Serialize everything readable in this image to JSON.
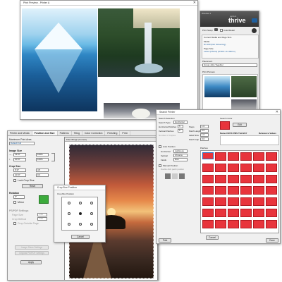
{
  "print_preview": {
    "title": "Print Preview - Printer A",
    "close_glyph": "✕"
  },
  "thrive": {
    "header_label": "Window 1",
    "logo_prefix": "perfect",
    "logo_main": "thrive",
    "print_setup_label": "Print Setup",
    "color_label": "Color/Detail",
    "current_media_label": "Current Media and Page Size",
    "media_label": "Media",
    "media_value": "Dit 100 (Dot Screening)",
    "page_size_label": "Page Size",
    "page_size_value": "Letter (8.5x11) (8.500 x 11.000 in)",
    "placement_label": "Placement",
    "placement_value": "Group Jobs Together",
    "print_preview_label": "Print Preview",
    "brand_color": "#1f5f9e"
  },
  "main": {
    "tabs": [
      "Printer and Media",
      "Position and Size",
      "Patterns",
      "Tiling",
      "Color Correction",
      "Finishing",
      "Print"
    ],
    "max_print_label": "Maximum Print Area",
    "max_print_value": "Default Full",
    "image_size_label": "Image Size",
    "img_w": "13.07",
    "img_w_pct": "100%",
    "img_h": "10.57",
    "img_h_pct": "100%",
    "crop_size_label": "Crop Size",
    "crop_w": "8.37",
    "crop_x": "4.8",
    "crop_h": "10.57",
    "crop_y": "0.0",
    "lock_crop_label": "Lock Crop Size",
    "reset_label": "Reset",
    "rotation_label": "Rotation",
    "rotation_value": "0°",
    "mirror_label": "Mirror",
    "pscrop_label": "PS/PDF Settings",
    "page_size_small": "Page Size",
    "page_size_small_val": "1.00",
    "crop_method_label": "Crop Method",
    "crop_method_val": "1.00",
    "crop_outside_label": "Crop Outside Page",
    "crop_apply_label": "Image Sizes Settings",
    "original_label": "Original PS/PDF Settings",
    "apply_label": "Apply",
    "filter_title": "Filter Bridge (Current)"
  },
  "crop_dialog": {
    "title": "Crop Box Position",
    "label": "Crop Box Position",
    "cancel_label": "Cancel"
  },
  "search_dialog": {
    "title": "Search Printer",
    "search_selection_label": "Search Selection",
    "search_type_label": "Search Type",
    "search_type_value": "Horizontal",
    "horizontal_patches_label": "Horizontal Patches",
    "horizontal_patches_value": "5",
    "vertical_patches_label": "Vertical Patches",
    "vertical_patches_value": "5",
    "number_of_copies_label": "Number of Copies",
    "steps_label": "Steps",
    "steps_value": "1.0",
    "patch_height_label": "Patch Height",
    "patch_height_value": "0.5",
    "label_size_label": "Label Size",
    "label_size_value": "1.0",
    "patch_gap_label": "Patch Gap",
    "patch_gap_value": "0.0",
    "swatch_color_label": "Search Color",
    "edit_label": "Edit",
    "name_table_label": "Name CMYK PMS Tbd BSY",
    "lab_label": "Reference Values",
    "auto_position_label": "Auto Position",
    "horizontal_label": "Horizontal",
    "horizontal_value": "Lightness",
    "vertical_label": "Vertical",
    "vertical_value": "Chroma",
    "fields_label": "Fields",
    "fields_value": "Hue",
    "manual_label": "Manual Position",
    "manual_sub": "Double click patch position",
    "patches_label": "Patches",
    "print_label": "Print",
    "cancel_label": "Cancel",
    "done_label": "Done",
    "swatch_color": "#e8343c"
  }
}
